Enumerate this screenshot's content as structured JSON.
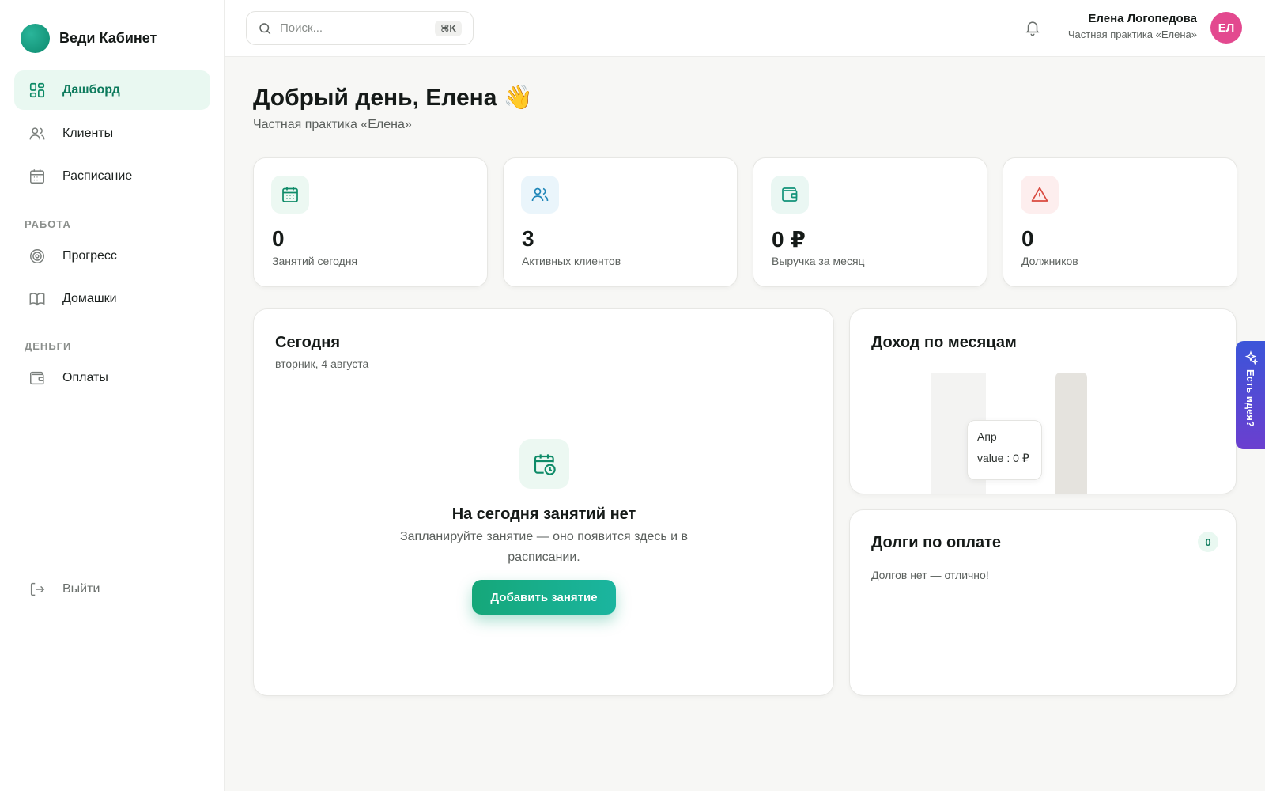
{
  "brand": {
    "name": "Веди Кабинет"
  },
  "sidebar": {
    "items": [
      {
        "label": "Дашборд",
        "icon": "dashboard-icon"
      },
      {
        "label": "Клиенты",
        "icon": "users-icon"
      },
      {
        "label": "Расписание",
        "icon": "calendar-icon"
      }
    ],
    "sections": [
      {
        "title": "РАБОТА",
        "items": [
          {
            "label": "Прогресс",
            "icon": "target-icon"
          },
          {
            "label": "Домашки",
            "icon": "book-icon"
          }
        ]
      },
      {
        "title": "ДЕНЬГИ",
        "items": [
          {
            "label": "Оплаты",
            "icon": "wallet-icon"
          }
        ]
      }
    ],
    "logout": "Выйти"
  },
  "search": {
    "placeholder": "Поиск...",
    "shortcut": "⌘K"
  },
  "user": {
    "name": "Елена Логопедова",
    "practice": "Частная практика «Елена»",
    "initials": "ЕЛ"
  },
  "greeting": {
    "title": "Добрый день, Елена 👋",
    "subtitle": "Частная практика «Елена»"
  },
  "stats": [
    {
      "value": "0",
      "label": "Занятий сегодня",
      "icon": "calendar-icon",
      "color": "#0e8b68",
      "bg": "#ecf8f2"
    },
    {
      "value": "3",
      "label": "Активных клиентов",
      "icon": "users-icon",
      "color": "#1f86b8",
      "bg": "#eaf5fb"
    },
    {
      "value": "0 ₽",
      "label": "Выручка за месяц",
      "icon": "wallet-icon",
      "color": "#12937a",
      "bg": "#eaf7f3"
    },
    {
      "value": "0",
      "label": "Должников",
      "icon": "warning-icon",
      "color": "#d9493f",
      "bg": "#fdeeee"
    }
  ],
  "today": {
    "title": "Сегодня",
    "date": "вторник, 4 августа",
    "empty_title": "На сегодня занятий нет",
    "empty_text": "Запланируйте занятие — оно появится здесь и в расписании.",
    "button": "Добавить занятие"
  },
  "income": {
    "title": "Доход по месяцам",
    "tooltip": {
      "label": "Апр",
      "value": "value : 0 ₽"
    }
  },
  "chart_data": {
    "type": "bar",
    "title": "Доход по месяцам",
    "categories": [
      "Апр"
    ],
    "values": [
      0
    ],
    "unit": "₽"
  },
  "debts": {
    "title": "Долги по оплате",
    "count": "0",
    "text": "Долгов нет — отлично!"
  },
  "feedback": {
    "label": "Есть идея?"
  },
  "colors": {
    "accent": "#0c8a66",
    "accent_bg": "#e9f8f1",
    "avatar": "#e3498f",
    "feedback": "#4a4ad6"
  }
}
